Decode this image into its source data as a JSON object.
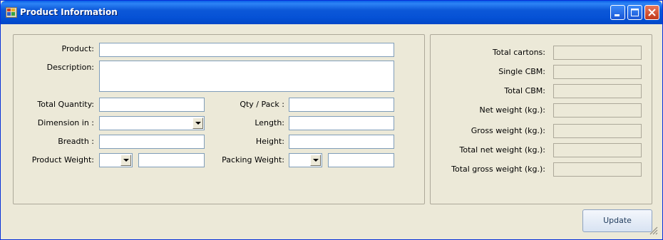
{
  "window": {
    "title": "Product Information"
  },
  "titlebar_buttons": {
    "minimize": "minimize-icon",
    "maximize": "maximize-icon",
    "close": "close-icon"
  },
  "form": {
    "product_label": "Product:",
    "product_value": "",
    "description_label": "Description:",
    "description_value": "",
    "total_quantity_label": "Total Quantity:",
    "total_quantity_value": "",
    "qty_pack_label": "Qty / Pack :",
    "qty_pack_value": "",
    "dimension_label": "Dimension in :",
    "dimension_value": "",
    "length_label": "Length:",
    "length_value": "",
    "breadth_label": "Breadth :",
    "breadth_value": "",
    "height_label": "Height:",
    "height_value": "",
    "product_weight_label": "Product Weight:",
    "product_weight_unit": "",
    "product_weight_value": "",
    "packing_weight_label": "Packing Weight:",
    "packing_weight_unit": "",
    "packing_weight_value": ""
  },
  "totals": {
    "total_cartons_label": "Total cartons:",
    "total_cartons_value": "",
    "single_cbm_label": "Single CBM:",
    "single_cbm_value": "",
    "total_cbm_label": "Total CBM:",
    "total_cbm_value": "",
    "net_weight_label": "Net weight (kg.):",
    "net_weight_value": "",
    "gross_weight_label": "Gross weight (kg.):",
    "gross_weight_value": "",
    "total_net_weight_label": "Total net weight (kg.):",
    "total_net_weight_value": "",
    "total_gross_weight_label": "Total gross weight (kg.):",
    "total_gross_weight_value": ""
  },
  "actions": {
    "update_label": "Update"
  }
}
